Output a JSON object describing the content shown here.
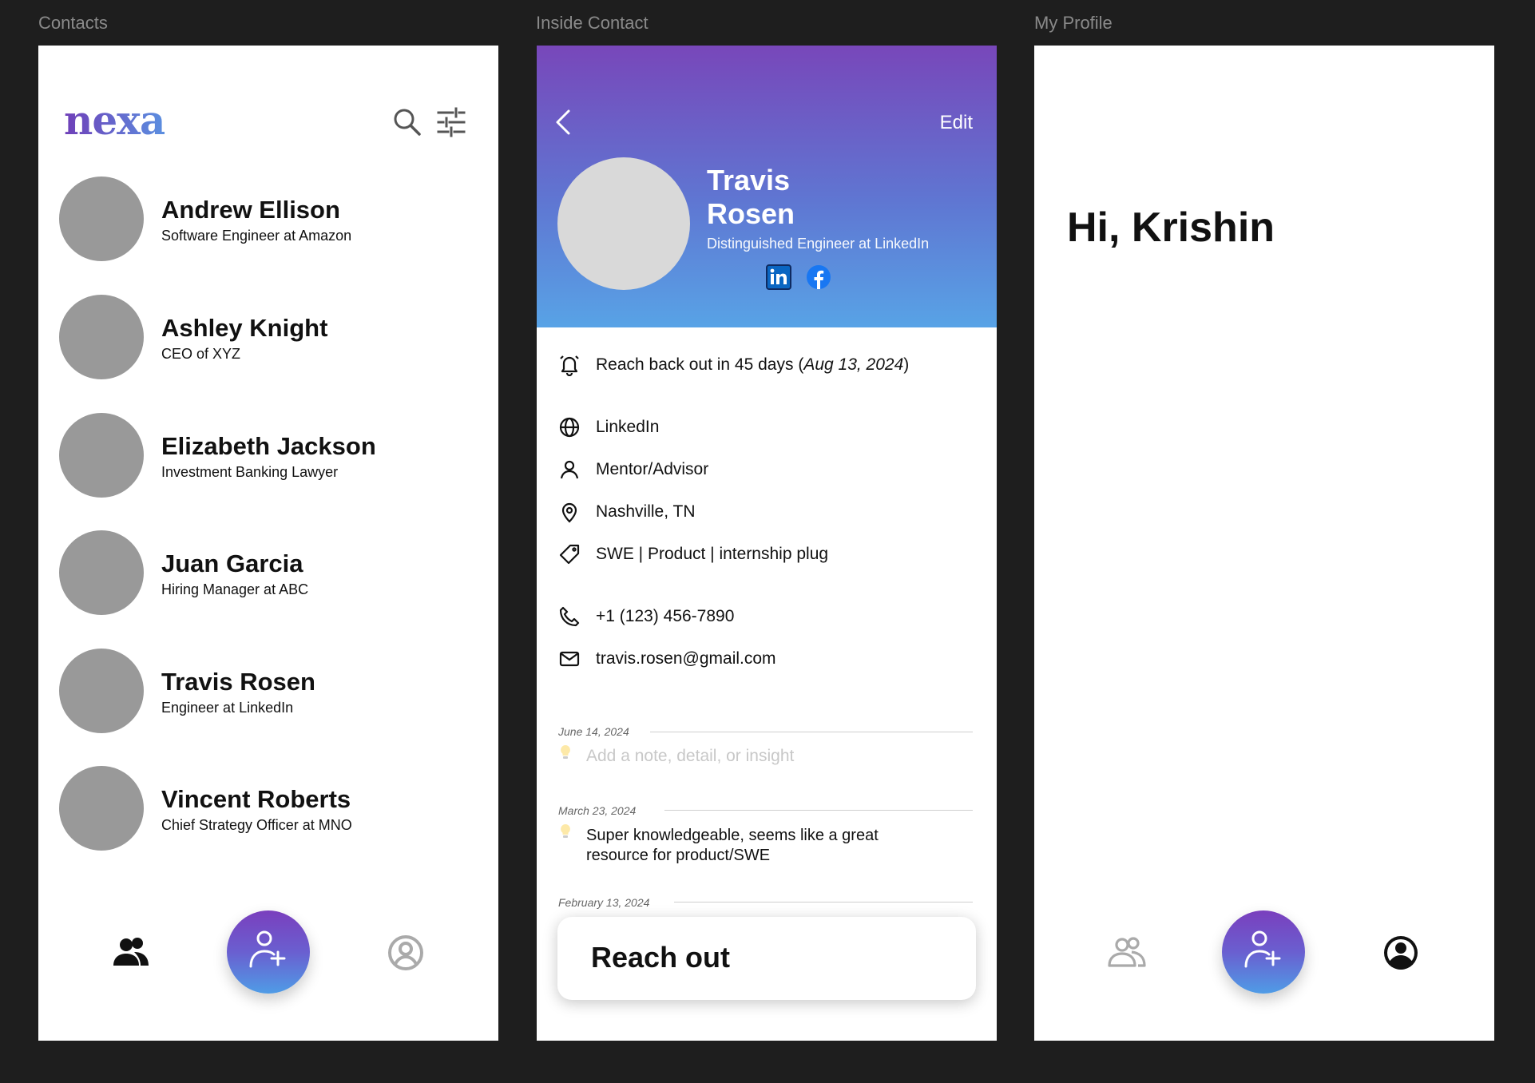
{
  "frames": {
    "contacts_label": "Contacts",
    "inside_label": "Inside Contact",
    "profile_label": "My Profile"
  },
  "contacts": {
    "logo": "nexa",
    "list": [
      {
        "name": "Andrew Ellison",
        "title": "Software Engineer at Amazon"
      },
      {
        "name": "Ashley Knight",
        "title": "CEO of XYZ"
      },
      {
        "name": "Elizabeth Jackson",
        "title": "Investment Banking Lawyer"
      },
      {
        "name": "Juan Garcia",
        "title": "Hiring Manager at ABC"
      },
      {
        "name": "Travis Rosen",
        "title": "Engineer at LinkedIn"
      },
      {
        "name": "Vincent Roberts",
        "title": "Chief Strategy Officer at MNO"
      }
    ]
  },
  "detail": {
    "edit_label": "Edit",
    "first_name": "Travis",
    "last_name": "Rosen",
    "title": "Distinguished Engineer at LinkedIn",
    "reminder_text": "Reach back out in 45 days (",
    "reminder_date": "Aug 13, 2024",
    "reminder_close": ")",
    "source": "LinkedIn",
    "relationship": "Mentor/Advisor",
    "location": "Nashville, TN",
    "tags": "SWE | Product | internship plug",
    "phone": "+1 (123) 456-7890",
    "email": "travis.rosen@gmail.com",
    "notes": [
      {
        "date": "June 14, 2024",
        "placeholder": "Add a note, detail, or insight"
      },
      {
        "date": "March 23, 2024",
        "text": "Super knowledgeable, seems like a great resource for product/SWE"
      },
      {
        "date": "February 13, 2024"
      }
    ],
    "reach_out_label": "Reach out"
  },
  "profile": {
    "greeting": "Hi, Krishin"
  },
  "colors": {
    "gradient_top": "#7847ba",
    "gradient_bottom": "#58a3e6",
    "avatar_gray": "#999999"
  }
}
